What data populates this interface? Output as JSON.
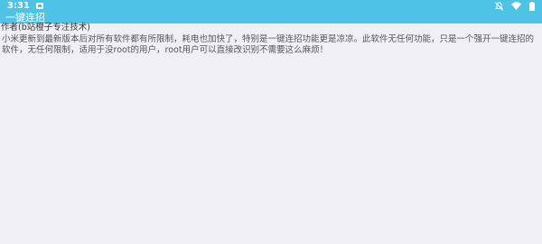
{
  "status_bar": {
    "time": "3:31"
  },
  "app": {
    "title": "一键连招"
  },
  "author_line": "作者(b站橙子专注技术)",
  "description": "小米更新到最新版本后对所有软件都有所限制，耗电也加快了，特别是一键连招功能更是凉凉。此软件无任何功能，只是一个强开一键连招的软件，无任何限制，适用于没root的用户，root用户可以直接改识别不需要这么麻烦！",
  "colors": {
    "app_bar": "#4fc3e6",
    "background": "#f0eff4"
  },
  "icons": [
    "notification-icon",
    "mute-icon",
    "wifi-icon",
    "battery-icon"
  ]
}
